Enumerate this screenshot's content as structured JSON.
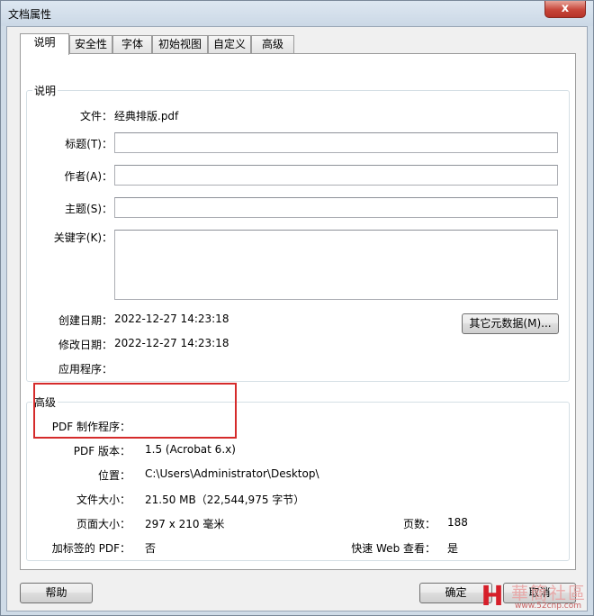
{
  "window": {
    "title": "文档属性",
    "close_glyph": "x"
  },
  "tabs": [
    {
      "label": "说明"
    },
    {
      "label": "安全性"
    },
    {
      "label": "字体"
    },
    {
      "label": "初始视图"
    },
    {
      "label": "自定义"
    },
    {
      "label": "高级"
    }
  ],
  "description": {
    "legend": "说明",
    "file_label": "文件：",
    "file_value": "经典排版.pdf",
    "title_label": "标题(T)：",
    "title_value": "",
    "author_label": "作者(A)：",
    "author_value": "",
    "subject_label": "主题(S)：",
    "subject_value": "",
    "keywords_label": "关键字(K)：",
    "keywords_value": "",
    "created_label": "创建日期：",
    "created_value": "2022-12-27 14:23:18",
    "modified_label": "修改日期：",
    "modified_value": "2022-12-27 14:23:18",
    "application_label": "应用程序：",
    "application_value": "",
    "metadata_button": "其它元数据(M)..."
  },
  "advanced": {
    "legend": "高级",
    "producer_label": "PDF 制作程序：",
    "producer_value": "",
    "version_label": "PDF 版本：",
    "version_value": "1.5 (Acrobat 6.x)",
    "location_label": "位置：",
    "location_value": "C:\\Users\\Administrator\\Desktop\\",
    "filesize_label": "文件大小：",
    "filesize_value": "21.50 MB（22,544,975 字节）",
    "pagesize_label": "页面大小：",
    "pagesize_value": "297 x 210 毫米",
    "pages_label": "页数：",
    "pages_value": "188",
    "tagged_label": "加标签的 PDF：",
    "tagged_value": "否",
    "fastweb_label": "快速 Web 查看：",
    "fastweb_value": "是"
  },
  "footer": {
    "help_button": "帮助",
    "ok_button": "确定",
    "cancel_button": "取消"
  },
  "watermark": {
    "logo": "H",
    "text": "華簡社區",
    "url": "www.52cnp.com"
  },
  "colors": {
    "highlight": "#d52b2b",
    "close": "#c7463a"
  }
}
